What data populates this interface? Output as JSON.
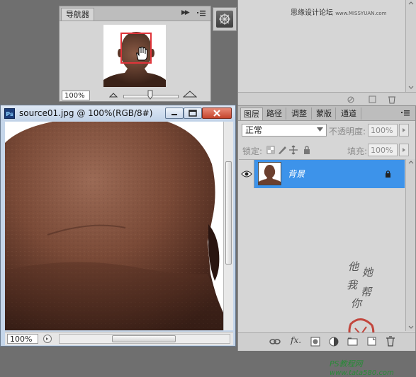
{
  "navigator": {
    "tab_label": "导航器",
    "collapse_glyph": "▶▶",
    "zoom_value": "100%"
  },
  "document": {
    "title": "source01.jpg @ 100%(RGB/8#)",
    "ps_badge": "Ps",
    "zoom_value": "100%"
  },
  "top_panel": {
    "watermark_cn": "思缘设计论坛",
    "watermark_site": "www.MISSYUAN.com"
  },
  "layers": {
    "tabs": [
      {
        "label": "图层",
        "active": true
      },
      {
        "label": "路径",
        "active": false
      },
      {
        "label": "调整",
        "active": false
      },
      {
        "label": "蒙版",
        "active": false
      },
      {
        "label": "通道",
        "active": false
      }
    ],
    "blend_mode": "正常",
    "opacity_label": "不透明度:",
    "opacity_value": "100%",
    "lock_label": "锁定:",
    "fill_label": "填充:",
    "fill_value": "100%",
    "layer_name": "背景",
    "watermark_cn": "PS教程网",
    "watermark_url": "www.tata580.com"
  },
  "colors": {
    "selection_blue": "#3d93ea",
    "close_red": "#c5442c",
    "navigator_box": "#e0343a",
    "watermark_green": "#2a8a38"
  },
  "icons": [
    "ps-icon",
    "hand-icon",
    "eye-icon",
    "lock-icon",
    "link-icon",
    "fx-icon",
    "mask-icon",
    "adjustment-icon",
    "folder-icon",
    "new-layer-icon",
    "trash-icon",
    "panel-menu-icon",
    "brush-tool-icon"
  ]
}
